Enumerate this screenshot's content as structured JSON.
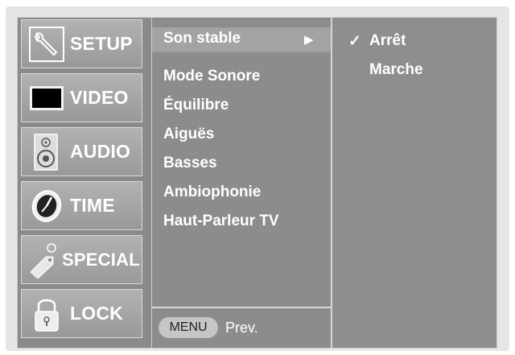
{
  "tabs": [
    {
      "label": "SETUP",
      "icon": "wrench-icon"
    },
    {
      "label": "VIDEO",
      "icon": "monitor-icon"
    },
    {
      "label": "AUDIO",
      "icon": "speaker-icon"
    },
    {
      "label": "TIME",
      "icon": "clock-icon"
    },
    {
      "label": "SPECIAL",
      "icon": "tag-icon"
    },
    {
      "label": "LOCK",
      "icon": "padlock-icon"
    }
  ],
  "menu": {
    "items": [
      "Son stable",
      "Mode Sonore",
      "Équilibre",
      "Aiguës",
      "Basses",
      "Ambiophonie",
      "Haut-Parleur TV"
    ],
    "selected_index": 0,
    "footer_button": "MENU",
    "footer_label": "Prev."
  },
  "options": {
    "items": [
      "Arrêt",
      "Marche"
    ],
    "checked_index": 0,
    "check_mark": "✓"
  },
  "colors": {
    "panel": "#8c8c8c",
    "tab": "#a5a5a5",
    "text": "#ffffff"
  }
}
